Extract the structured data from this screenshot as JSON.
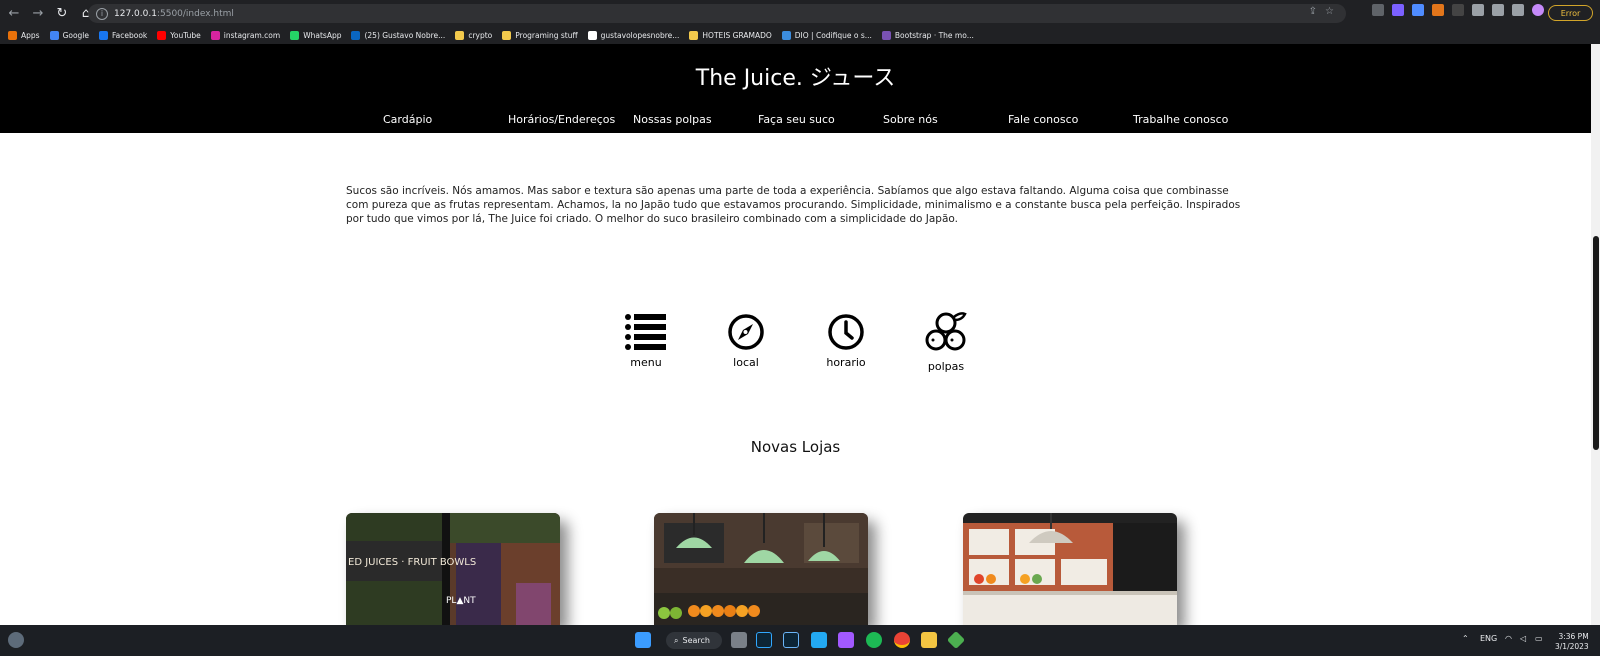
{
  "browser": {
    "url_host": "127.0.0.1",
    "url_rest": ":5500/index.html",
    "error_badge": "Error",
    "bookmarks": [
      {
        "label": "Apps",
        "color": "#e8710a"
      },
      {
        "label": "Google",
        "color": "#4285f4"
      },
      {
        "label": "Facebook",
        "color": "#1877f2"
      },
      {
        "label": "YouTube",
        "color": "#ff0000"
      },
      {
        "label": "instagram.com",
        "color": "#d6249f"
      },
      {
        "label": "WhatsApp",
        "color": "#25d366"
      },
      {
        "label": "(25) Gustavo Nobre...",
        "color": "#0a66c2"
      },
      {
        "label": "crypto",
        "color": "#f2c94c"
      },
      {
        "label": "Programing stuff",
        "color": "#f2c94c"
      },
      {
        "label": "gustavolopesnobre...",
        "color": "#ffffff"
      },
      {
        "label": "HOTEIS GRAMADO",
        "color": "#f2c94c"
      },
      {
        "label": "DIO | Codifique o s...",
        "color": "#3c8dde"
      },
      {
        "label": "Bootstrap · The mo...",
        "color": "#7952b3"
      }
    ]
  },
  "site": {
    "title": "The Juice. ジュース",
    "nav": [
      "Cardápio",
      "Horários/Endereços",
      "Nossas polpas",
      "Faça seu suco",
      "Sobre nós",
      "Fale conosco",
      "Trabalhe conosco"
    ],
    "intro": "Sucos são incríveis. Nós amamos. Mas sabor e textura são apenas uma parte de toda a experiência. Sabíamos que algo estava faltando. Alguma coisa que combinasse com pureza que as frutas representam. Achamos, la no Japão tudo que estavamos procurando. Simplicidade, minimalismo e a constante busca pela perfeição. Inspirados por tudo que vimos por lá, The Juice foi criado. O melhor do suco brasileiro combinado com a simplicidade do Japão.",
    "features": [
      {
        "label": "menu",
        "icon": "list-icon"
      },
      {
        "label": "local",
        "icon": "compass-icon"
      },
      {
        "label": "horario",
        "icon": "clock-icon"
      },
      {
        "label": "polpas",
        "icon": "fruit-icon"
      }
    ],
    "section_title": "Novas Lojas",
    "stores": [
      {
        "sign": "ED JUICES · FRUIT BOWLS",
        "logo": "PL▲NT"
      },
      {
        "sign": ""
      },
      {
        "sign": ""
      }
    ]
  },
  "taskbar": {
    "search": "Search",
    "lang": "ENG",
    "time": "3:36 PM",
    "date": "3/1/2023"
  }
}
